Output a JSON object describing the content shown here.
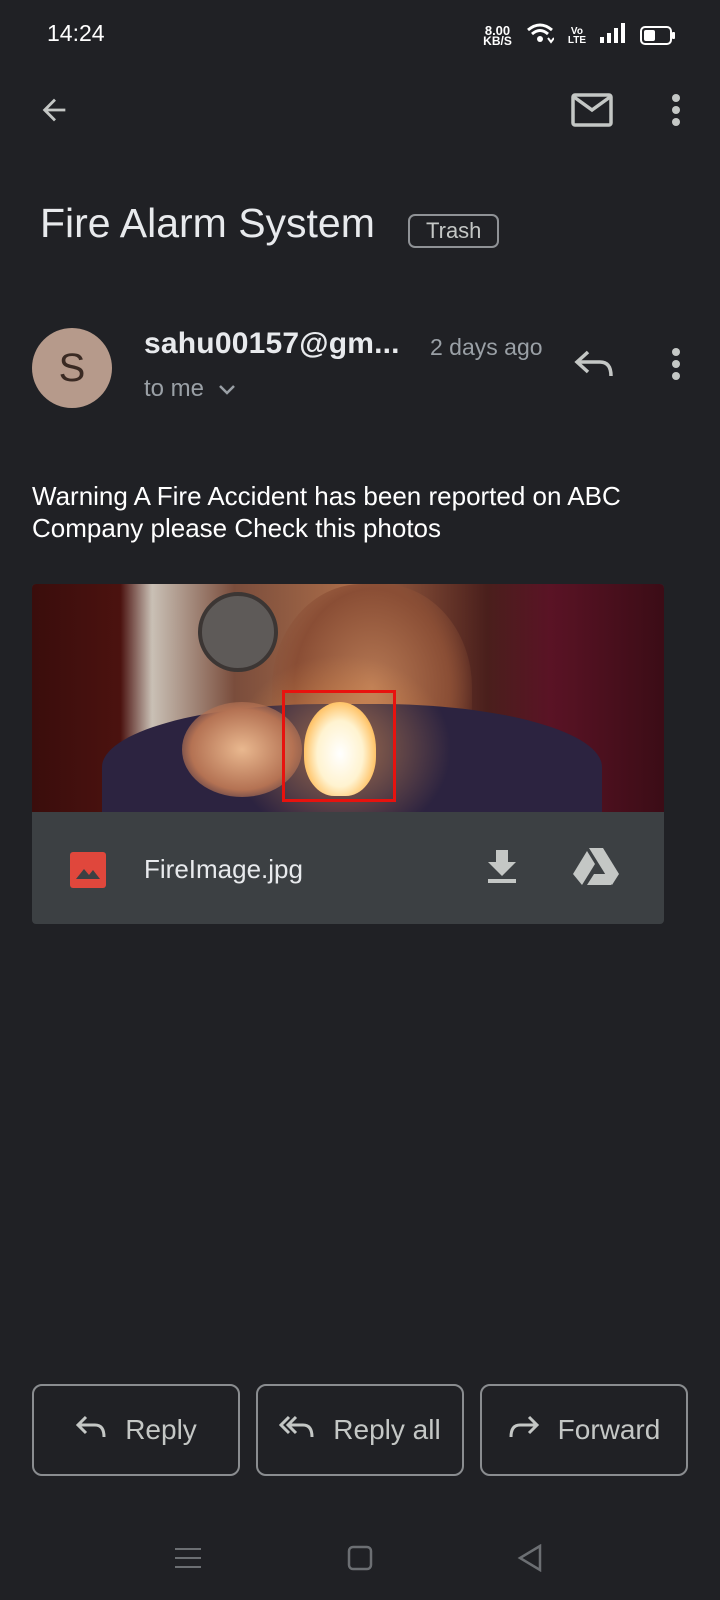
{
  "status_bar": {
    "time": "14:24",
    "net_speed": "8.00",
    "net_unit": "KB/S",
    "volte_top": "Vo",
    "volte_bottom": "LTE",
    "battery_level": 0.45
  },
  "toolbar": {
    "back_icon": "arrow-back-icon",
    "mail_icon": "mark-unread-mail-icon",
    "more_icon": "more-vert-icon"
  },
  "email": {
    "subject": "Fire Alarm System",
    "label": "Trash",
    "sender_initial": "S",
    "sender": "sahu00157@gm...",
    "date": "2 days ago",
    "recipient": "to me",
    "body": "Warning A Fire Accident has been reported on ABC Company please Check this photos"
  },
  "attachment": {
    "file_name": "FireImage.jpg",
    "type_icon": "image-file-icon",
    "download_icon": "download-icon",
    "drive_icon": "drive-icon"
  },
  "actions": {
    "reply": "Reply",
    "reply_all": "Reply all",
    "forward": "Forward"
  },
  "colors": {
    "background": "#202125",
    "card": "#3c4043",
    "avatar": "#b69a8b",
    "file_icon": "#e0473c",
    "detect_box": "#e8120e"
  }
}
